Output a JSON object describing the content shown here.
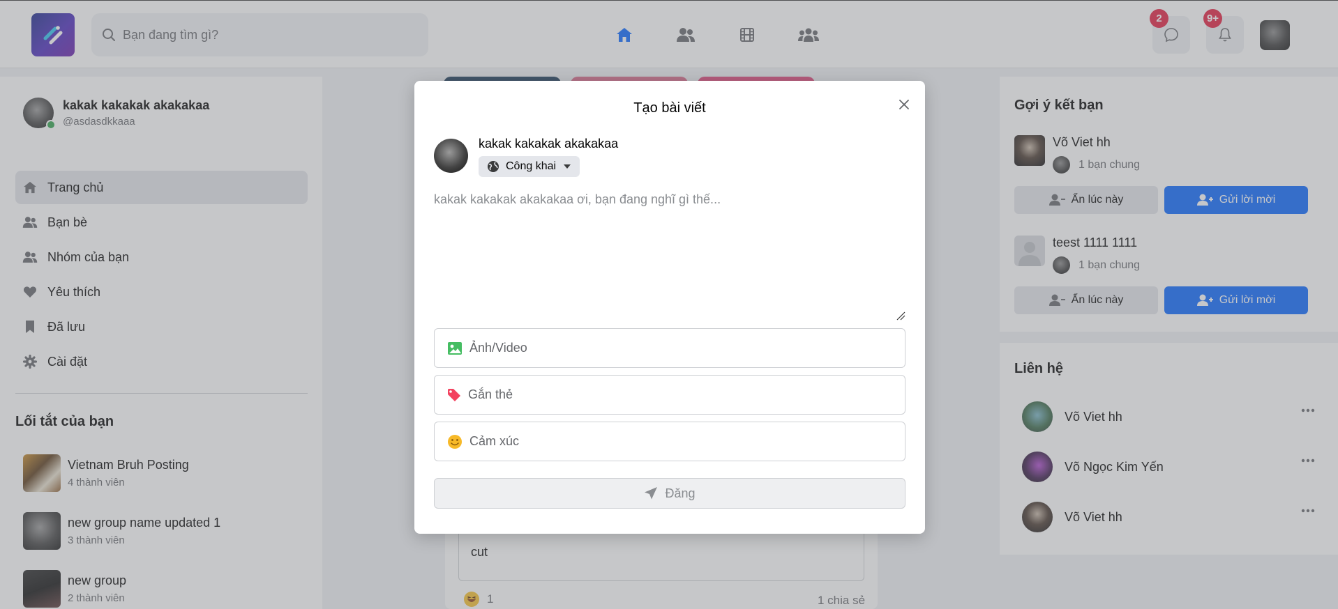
{
  "header": {
    "search_placeholder": "Bạn đang tìm gì?",
    "messages_badge": "2",
    "notifications_badge": "9+"
  },
  "profile": {
    "name": "kakak kakakak akakakaa",
    "handle": "@asdasdkkaaa"
  },
  "menu": [
    {
      "label": "Trang chủ"
    },
    {
      "label": "Bạn bè"
    },
    {
      "label": "Nhóm của bạn"
    },
    {
      "label": "Yêu thích"
    },
    {
      "label": "Đã lưu"
    },
    {
      "label": "Cài đặt"
    }
  ],
  "shortcuts": {
    "title": "Lối tắt của bạn",
    "items": [
      {
        "name": "Vietnam Bruh Posting",
        "members": "4 thành viên"
      },
      {
        "name": "new group name updated 1",
        "members": "3 thành viên"
      },
      {
        "name": "new group",
        "members": "2 thành viên"
      }
    ]
  },
  "suggestions": {
    "title": "Gợi ý kết bạn",
    "items": [
      {
        "name": "Võ Viet hh",
        "mutual": "1 bạn chung"
      },
      {
        "name": "teest 1111 1111",
        "mutual": "1 bạn chung"
      }
    ],
    "hide_label": "Ẩn lúc này",
    "add_label": "Gửi lời mời"
  },
  "contacts": {
    "title": "Liên hệ",
    "items": [
      {
        "name": "Võ Viet hh"
      },
      {
        "name": "Võ Ngọc Kim Yến"
      },
      {
        "name": "Võ Viet hh"
      }
    ]
  },
  "feed_post": {
    "text": "cut",
    "reaction_count": "1",
    "shares": "1 chia sẻ"
  },
  "modal": {
    "title": "Tạo bài viết",
    "author": "kakak kakakak akakakaa",
    "privacy": "Công khai",
    "placeholder": "kakak kakakak akakakaa ơi, bạn đang nghĩ gì thế...",
    "options": {
      "media": "Ảnh/Video",
      "tag": "Gắn thẻ",
      "feeling": "Cảm xúc"
    },
    "submit": "Đăng"
  },
  "colors": {
    "primary": "#0866ff",
    "badge": "#e41e3f",
    "online": "#31a24c"
  }
}
